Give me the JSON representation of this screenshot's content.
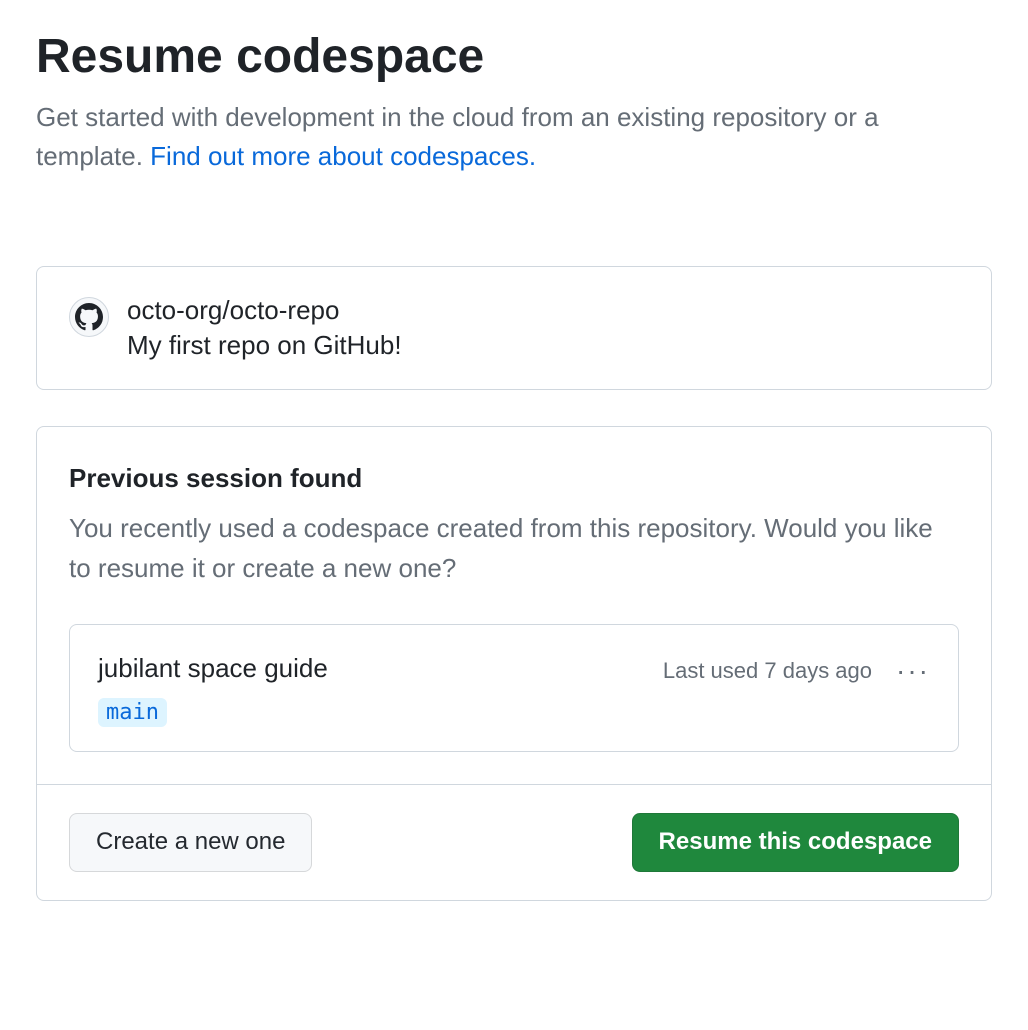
{
  "header": {
    "title": "Resume codespace",
    "subtitle_text": "Get started with development in the cloud from an existing repository or a template. ",
    "subtitle_link": "Find out more about codespaces."
  },
  "repository": {
    "full_name": "octo-org/octo-repo",
    "description": "My first repo on GitHub!"
  },
  "session": {
    "heading": "Previous session found",
    "description": "You recently used a codespace created from this repository. Would you like to resume it or create a new one?",
    "codespace": {
      "name": "jubilant space guide",
      "branch": "main",
      "last_used": "Last used 7 days ago"
    }
  },
  "actions": {
    "create_new": "Create a new one",
    "resume": "Resume this codespace"
  }
}
